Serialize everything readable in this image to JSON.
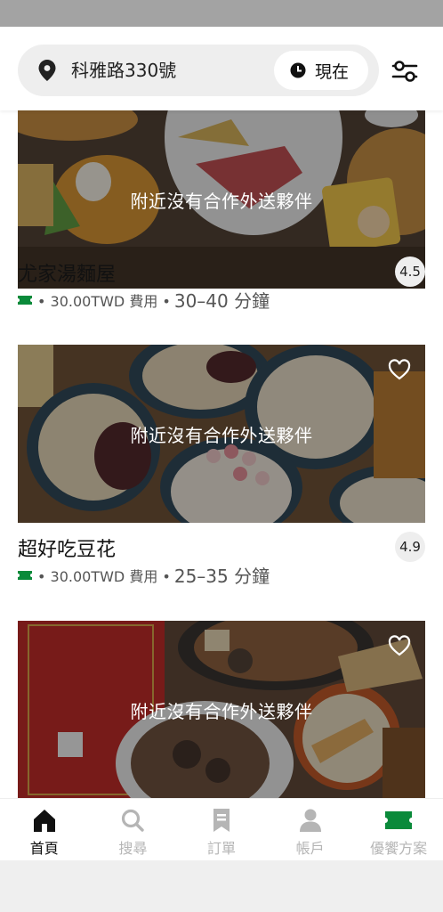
{
  "header": {
    "address": "科雅路330號",
    "time_label": "現在"
  },
  "colors": {
    "accent_green": "#0a8a3a",
    "nav_inactive": "#b5b5b5",
    "pill_background": "#eeeeee"
  },
  "stores": [
    {
      "name": "尤家湯麵屋",
      "unavailable": "附近沒有合作外送夥伴",
      "rating": "4.5",
      "fee": "• 30.00TWD 費用 •",
      "eta": "30–40 分鐘"
    },
    {
      "name": "超好吃豆花",
      "unavailable": "附近沒有合作外送夥伴",
      "rating": "4.9",
      "fee": "• 30.00TWD 費用 •",
      "eta": "25–35 分鐘"
    },
    {
      "name": "",
      "unavailable": "附近沒有合作外送夥伴"
    }
  ],
  "nav": {
    "items": [
      {
        "label": "首頁",
        "icon": "home-icon",
        "active": true
      },
      {
        "label": "搜尋",
        "icon": "search-icon",
        "active": false
      },
      {
        "label": "訂單",
        "icon": "receipt-icon",
        "active": false
      },
      {
        "label": "帳戶",
        "icon": "person-icon",
        "active": false
      },
      {
        "label": "優饗方案",
        "icon": "ticket-icon",
        "active": false
      }
    ]
  }
}
